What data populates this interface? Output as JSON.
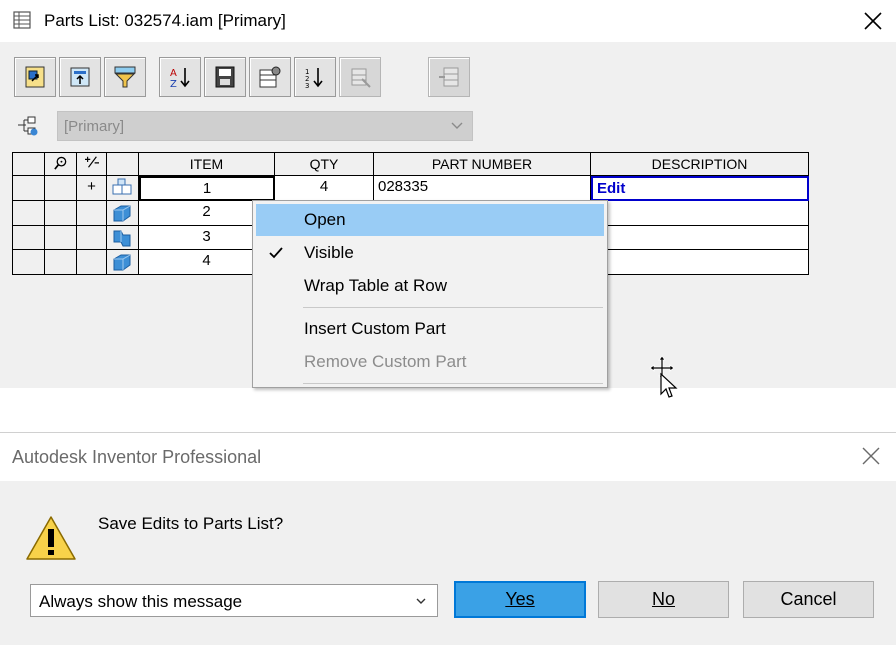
{
  "parts_window": {
    "title": "Parts List: 032574.iam [Primary]",
    "toolbar": [
      {
        "icon": "column-chooser-icon"
      },
      {
        "icon": "group-settings-icon"
      },
      {
        "icon": "filter-settings-icon"
      },
      {
        "icon": "sort-icon"
      },
      {
        "icon": "export-icon"
      },
      {
        "icon": "table-layout-icon"
      },
      {
        "icon": "renumber-items-icon"
      },
      {
        "icon": "bom-override-icon",
        "disabled": true
      },
      {
        "icon": "membership-icon",
        "disabled": true
      }
    ],
    "view_select": {
      "value": "[Primary]"
    },
    "columns": [
      "ITEM",
      "QTY",
      "PART NUMBER",
      "DESCRIPTION"
    ],
    "rows": [
      {
        "expand": "+",
        "item": "1",
        "qty": "4",
        "part_number": "028335",
        "description": "Edit",
        "icon": "assembly-icon"
      },
      {
        "expand": "",
        "item": "2",
        "qty": "",
        "part_number": "",
        "description": "",
        "icon": "part-icon"
      },
      {
        "expand": "",
        "item": "3",
        "qty": "",
        "part_number": "",
        "description": "",
        "icon": "part-icon"
      },
      {
        "expand": "",
        "item": "4",
        "qty": "",
        "part_number": "",
        "description": "",
        "icon": "part-icon"
      }
    ],
    "context_menu": {
      "items": [
        {
          "label": "Open",
          "state": "hover"
        },
        {
          "label": "Visible",
          "checked": true
        },
        {
          "label": "Wrap Table at Row"
        },
        {
          "label": "Insert Custom Part"
        },
        {
          "label": "Remove Custom Part",
          "disabled": true
        }
      ]
    }
  },
  "dialog": {
    "title": "Autodesk Inventor Professional",
    "message": "Save Edits to Parts List?",
    "suppress_option": "Always show this message",
    "buttons": {
      "yes": "Yes",
      "no": "No",
      "cancel": "Cancel"
    }
  },
  "colors": {
    "accent": "#0078d7",
    "highlight": "#99ccf5",
    "edit_text": "#0000cc"
  }
}
